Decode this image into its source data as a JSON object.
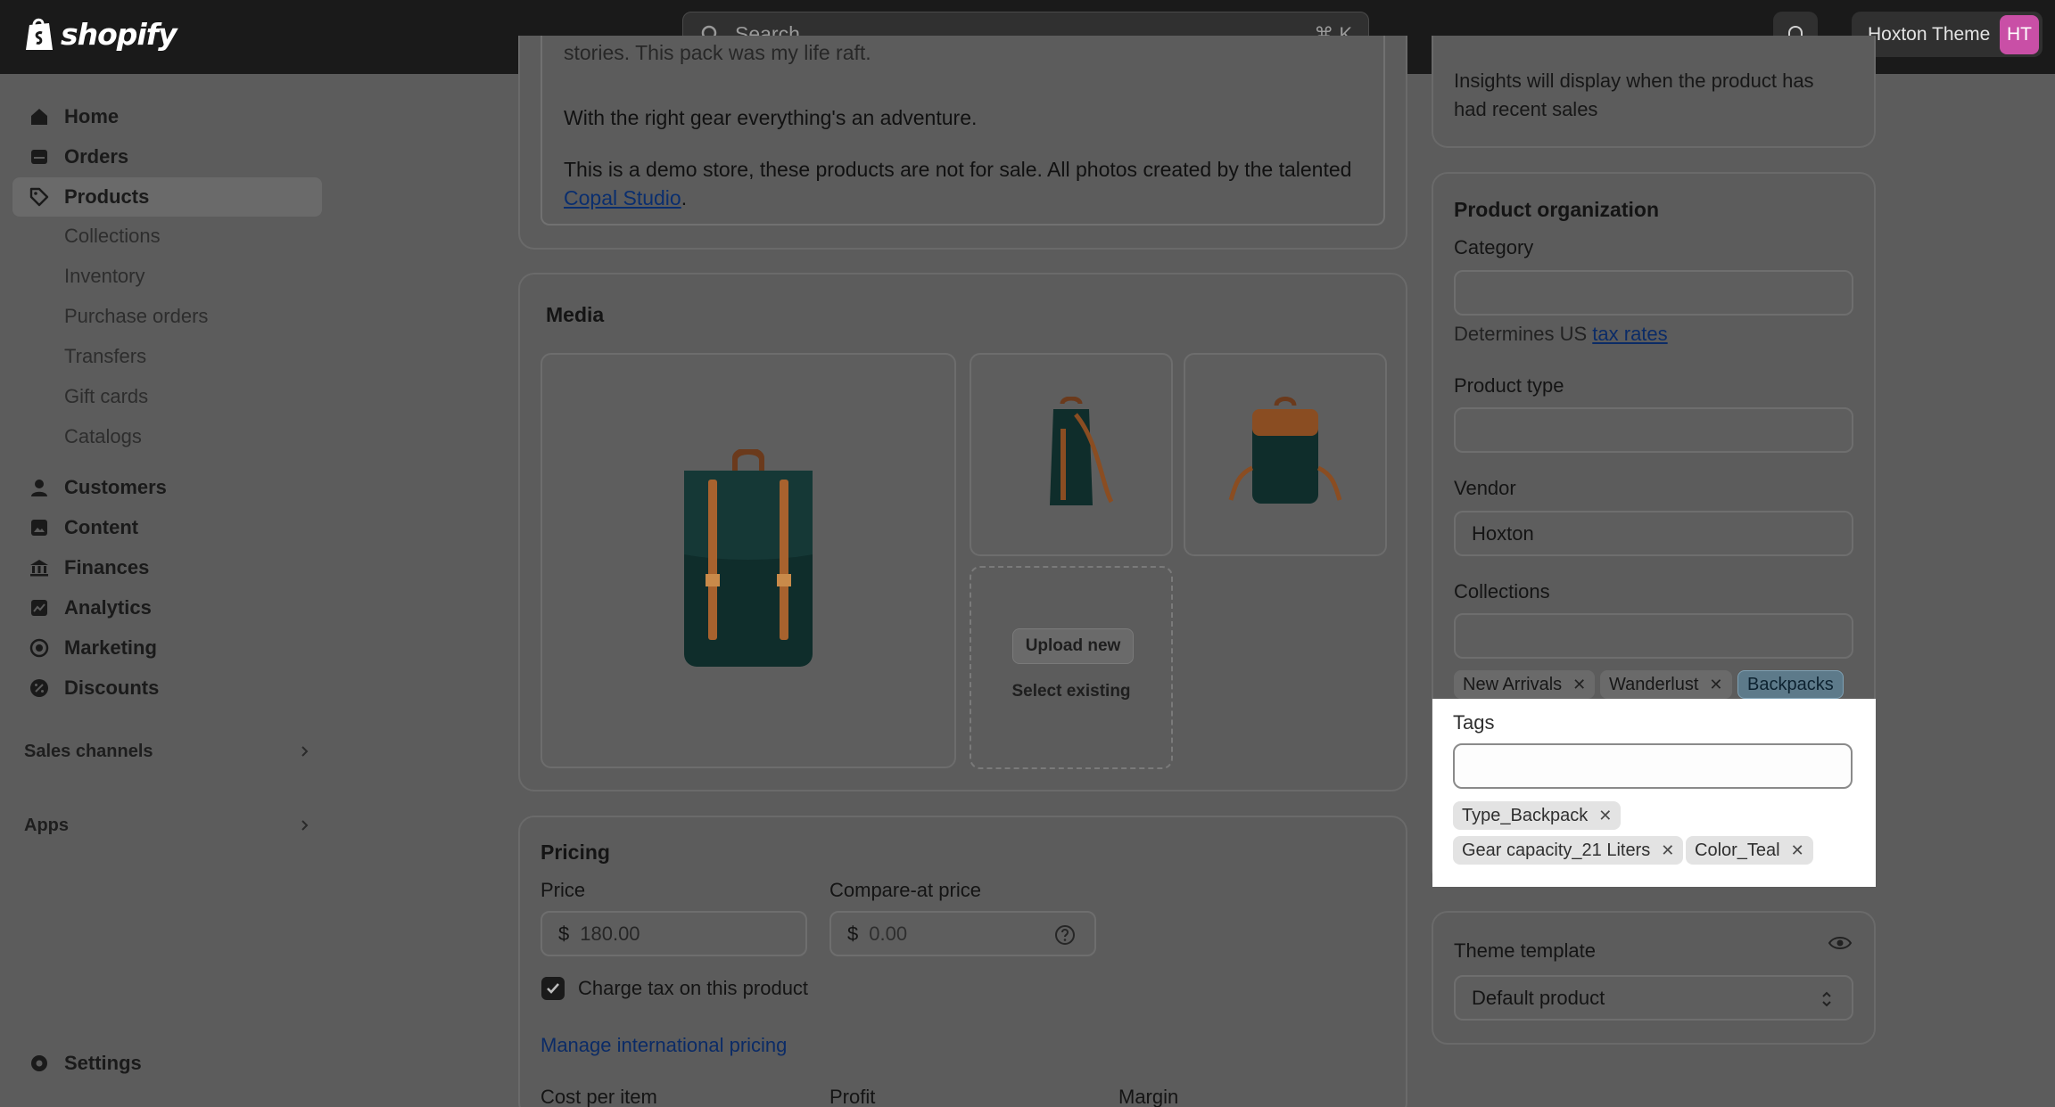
{
  "topbar": {
    "brand": "shopify",
    "search_placeholder": "Search",
    "search_shortcut": "⌘ K",
    "store_name": "Hoxton Theme",
    "avatar_initials": "HT"
  },
  "sidebar": {
    "items": [
      {
        "label": "Home",
        "icon": "home-icon"
      },
      {
        "label": "Orders",
        "icon": "orders-icon"
      },
      {
        "label": "Products",
        "icon": "tag-icon"
      },
      {
        "label": "Customers",
        "icon": "person-icon"
      },
      {
        "label": "Content",
        "icon": "content-icon"
      },
      {
        "label": "Finances",
        "icon": "bank-icon"
      },
      {
        "label": "Analytics",
        "icon": "chart-icon"
      },
      {
        "label": "Marketing",
        "icon": "target-icon"
      },
      {
        "label": "Discounts",
        "icon": "discount-icon"
      }
    ],
    "product_subitems": [
      "Collections",
      "Inventory",
      "Purchase orders",
      "Transfers",
      "Gift cards",
      "Catalogs"
    ],
    "sales_channels": "Sales channels",
    "apps": "Apps",
    "settings": "Settings"
  },
  "description": {
    "line1": "stories. This pack was my life raft.",
    "line2": "With the right gear everything's an adventure.",
    "line3": "This is a demo store, these products are not for sale. All photos created by the talented",
    "link": "Copal Studio",
    "after_link": "."
  },
  "media": {
    "title": "Media",
    "upload_label": "Upload new",
    "select_label": "Select existing"
  },
  "pricing": {
    "title": "Pricing",
    "price_label": "Price",
    "price_prefix": "$",
    "price_value": "180.00",
    "compare_label": "Compare-at price",
    "compare_prefix": "$",
    "compare_value": "0.00",
    "charge_tax_label": "Charge tax on this product",
    "manage_intl": "Manage international pricing",
    "cost_label": "Cost per item",
    "profit_label": "Profit",
    "margin_label": "Margin"
  },
  "insights": {
    "text_line1": "Insights will display when the product has",
    "text_line2": "had recent sales"
  },
  "organization": {
    "title": "Product organization",
    "category_label": "Category",
    "category_hint_prefix": "Determines US",
    "category_hint_link": "tax rates",
    "type_label": "Product type",
    "vendor_label": "Vendor",
    "vendor_value": "Hoxton",
    "collections_label": "Collections",
    "collections": [
      "New Arrivals",
      "Wanderlust",
      "Backpacks"
    ],
    "tags_label": "Tags",
    "tags": [
      "Type_Backpack",
      "Gear capacity_21 Liters",
      "Color_Teal"
    ]
  },
  "theme": {
    "label": "Theme template",
    "value": "Default product"
  },
  "colors": {
    "topbar": "#1a1a1a",
    "overlay": "#5c5c5c",
    "link": "#0b2b66",
    "avatar": "#c94fa6"
  }
}
